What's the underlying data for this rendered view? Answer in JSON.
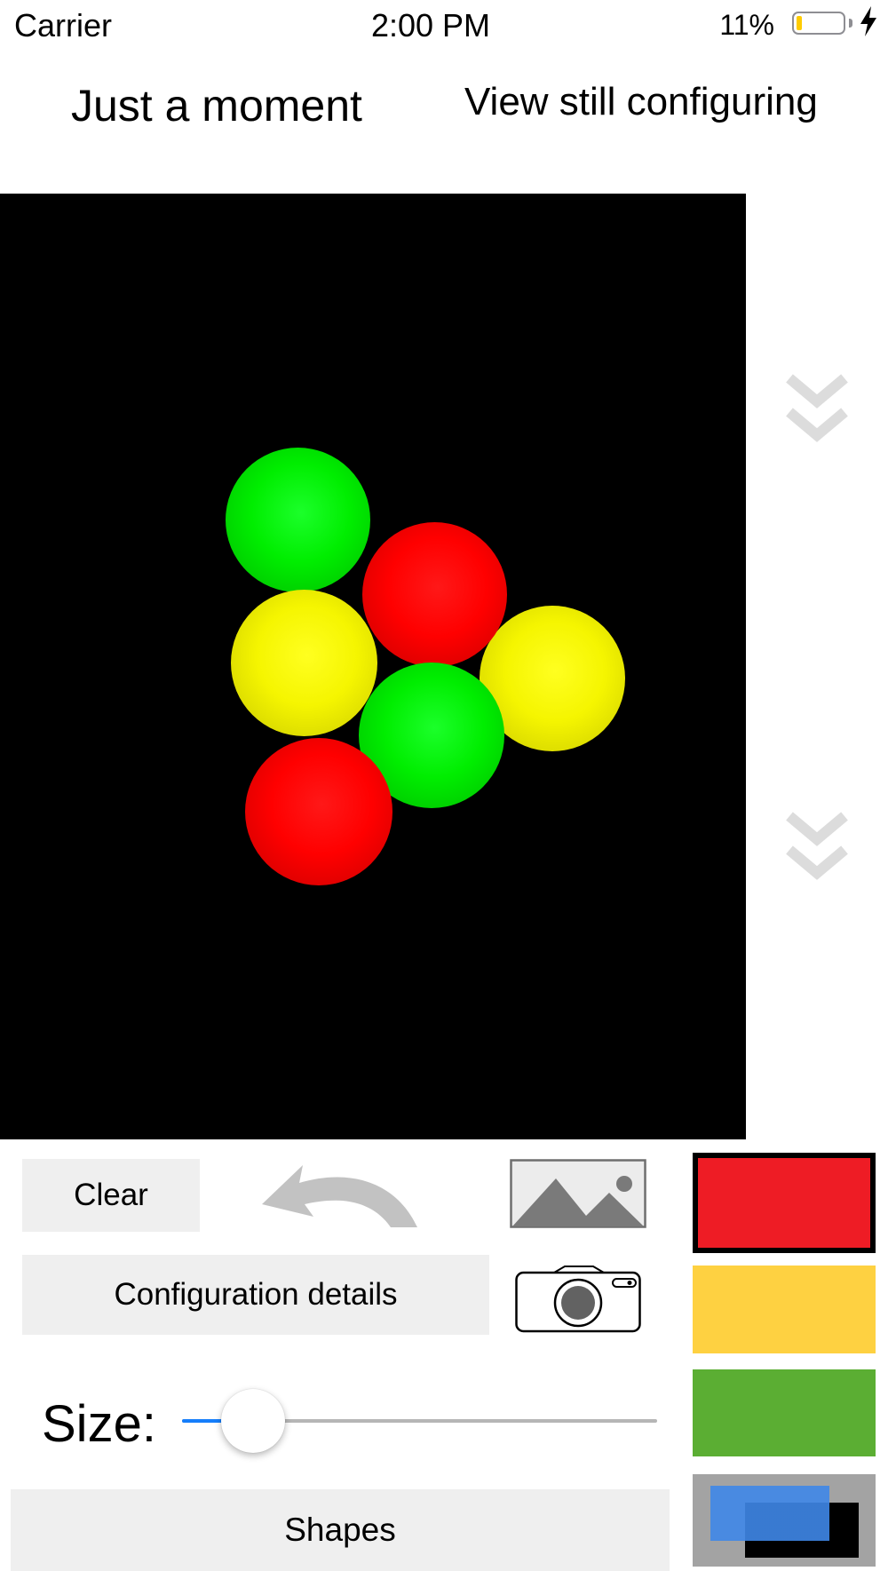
{
  "status_bar": {
    "carrier": "Carrier",
    "time": "2:00 PM",
    "battery_percent": "11%",
    "battery_level": 0.11,
    "charging": true
  },
  "header": {
    "left_label": "Just a moment",
    "right_label": "View still configuring"
  },
  "viewport": {
    "background": "#000000",
    "objects": [
      {
        "shape": "sphere",
        "color": "green"
      },
      {
        "shape": "sphere",
        "color": "red"
      },
      {
        "shape": "sphere",
        "color": "yellow"
      },
      {
        "shape": "sphere",
        "color": "yellow"
      },
      {
        "shape": "sphere",
        "color": "green"
      },
      {
        "shape": "sphere",
        "color": "red"
      }
    ]
  },
  "side_icons": [
    "double-chevron-down-icon",
    "double-chevron-down-icon"
  ],
  "controls": {
    "clear_label": "Clear",
    "undo_icon": "undo-arrow-icon",
    "photo_icon": "photo-library-icon",
    "camera_icon": "camera-icon",
    "config_label": "Configuration details",
    "size_label": "Size:",
    "size_value": 0.15,
    "shapes_label": "Shapes"
  },
  "colors": {
    "swatches": [
      {
        "name": "red",
        "hex": "#ee1c25",
        "selected": true
      },
      {
        "name": "yellow",
        "hex": "#fed141"
      },
      {
        "name": "green",
        "hex": "#5bae33"
      },
      {
        "name": "gradient",
        "hex": "#a3a3a3",
        "fg": "#3f87e8",
        "overlay": "#0040a8"
      }
    ],
    "slider_min": "#157efb",
    "slider_max": "#b6b6b6"
  }
}
